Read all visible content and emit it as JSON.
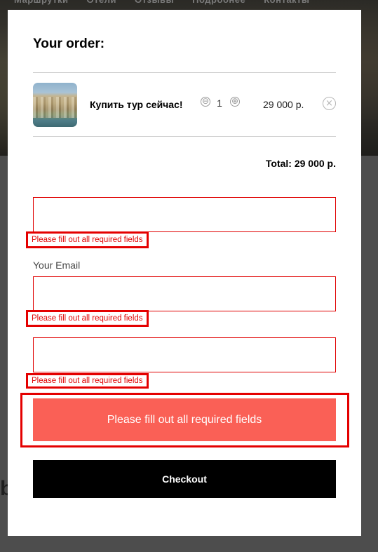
{
  "background": {
    "nav_items": [
      "Маршрутки",
      "Отели",
      "Отзывы",
      "Подробнее",
      "Контакты"
    ],
    "partial_heading": "b"
  },
  "order": {
    "title": "Your order:",
    "product": {
      "name": "Купить тур сейчас!",
      "quantity": "1",
      "price": "29 000 р."
    },
    "controls": {
      "minus_icon": "⊖",
      "plus_icon": "⊕",
      "remove_icon": "×"
    },
    "total": "Total: 29 000 р."
  },
  "form": {
    "field1": {
      "value": "",
      "error": "Please fill out all required fields"
    },
    "email": {
      "label": "Your Email",
      "value": "",
      "error": "Please fill out all required fields"
    },
    "field3": {
      "value": "",
      "error": "Please fill out all required fields"
    },
    "alert": "Please fill out all required fields",
    "checkout_label": "Checkout"
  },
  "colors": {
    "error": "#e00000",
    "alert_bg": "#fa6056",
    "button_bg": "#000000"
  }
}
